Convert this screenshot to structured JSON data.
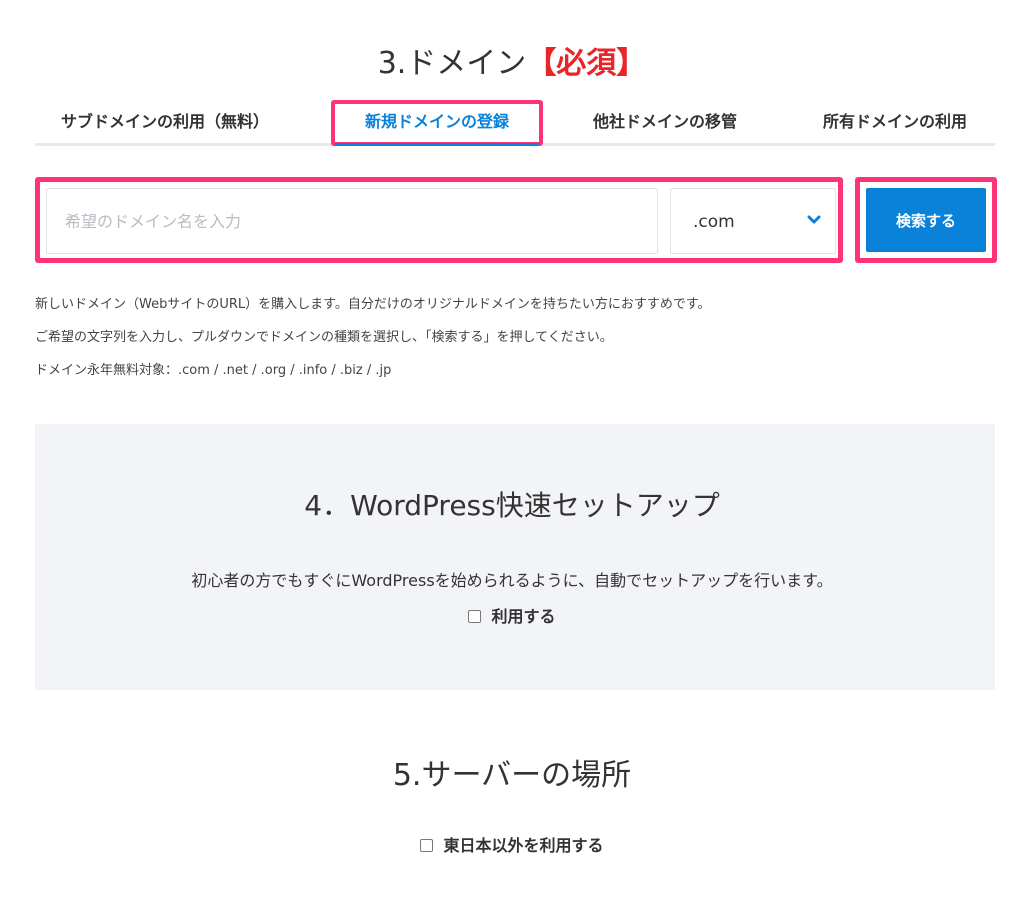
{
  "domain_section": {
    "title": "3.ドメイン",
    "required_label": "【必須】",
    "tabs": [
      {
        "label": "サブドメインの利用（無料）"
      },
      {
        "label": "新規ドメインの登録"
      },
      {
        "label": "他社ドメインの移管"
      },
      {
        "label": "所有ドメインの利用"
      }
    ],
    "active_tab": 1,
    "input_placeholder": "希望のドメイン名を入力",
    "input_value": "",
    "tld_selected": ".com",
    "search_button_label": "検索する",
    "description_lines": [
      "新しいドメイン（WebサイトのURL）を購入します。自分だけのオリジナルドメインを持ちたい方におすすめです。",
      "ご希望の文字列を入力し、プルダウンでドメインの種類を選択し、「検索する」を押してください。",
      "ドメイン永年無料対象：.com / .net / .org / .info / .biz / .jp"
    ]
  },
  "wordpress_section": {
    "title": "4．WordPress快速セットアップ",
    "description": "初心者の方でもすぐにWordPressを始められるように、自動でセットアップを行います。",
    "checkbox_label": "利用する",
    "checked": false
  },
  "server_section": {
    "title": "5.サーバーの場所",
    "checkbox_label": "東日本以外を利用する",
    "checked": false
  },
  "colors": {
    "accent_blue": "#0b82d9",
    "highlight_pink": "#ff3377",
    "required_red": "#e8262a",
    "panel_bg": "#f3f4f7"
  },
  "icons": {
    "tld_dropdown": "chevron-down-icon"
  }
}
